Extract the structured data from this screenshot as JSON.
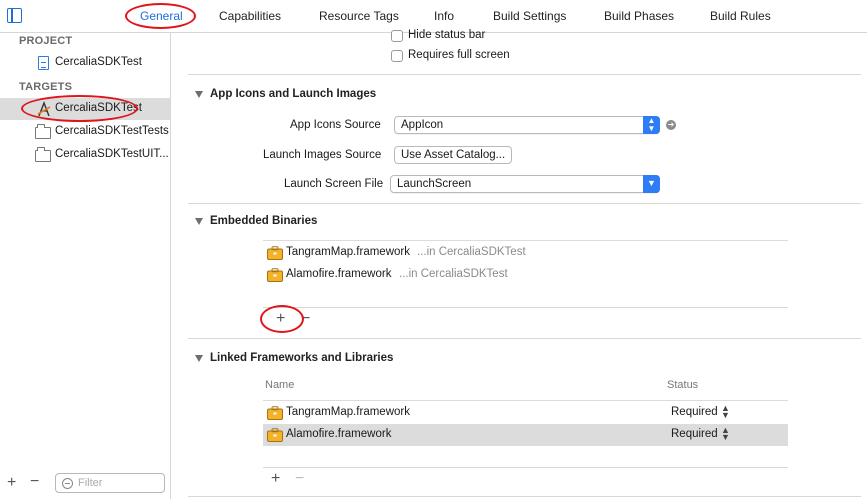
{
  "tabs": [
    {
      "label": "General",
      "active": true
    },
    {
      "label": "Capabilities"
    },
    {
      "label": "Resource Tags"
    },
    {
      "label": "Info"
    },
    {
      "label": "Build Settings"
    },
    {
      "label": "Build Phases"
    },
    {
      "label": "Build Rules"
    }
  ],
  "sidebar": {
    "project_header": "PROJECT",
    "project_item": "CercaliaSDKTest",
    "targets_header": "TARGETS",
    "targets": [
      {
        "label": "CercaliaSDKTest",
        "selected": true
      },
      {
        "label": "CercaliaSDKTestTests"
      },
      {
        "label": "CercaliaSDKTestUIT..."
      }
    ],
    "add_label": "+",
    "remove_label": "−",
    "filter_placeholder": "Filter"
  },
  "status_bar_options": {
    "hide_status_bar": "Hide status bar",
    "requires_full_screen": "Requires full screen"
  },
  "app_icons_section": {
    "title": "App Icons and Launch Images",
    "app_icons_source_label": "App Icons Source",
    "app_icons_source_value": "AppIcon",
    "launch_images_source_label": "Launch Images Source",
    "launch_images_button": "Use Asset Catalog...",
    "launch_screen_file_label": "Launch Screen File",
    "launch_screen_file_value": "LaunchScreen"
  },
  "embedded_binaries": {
    "title": "Embedded Binaries",
    "items": [
      {
        "name": "TangramMap.framework",
        "location": "...in CercaliaSDKTest"
      },
      {
        "name": "Alamofire.framework",
        "location": "...in CercaliaSDKTest"
      }
    ],
    "add_label": "+",
    "remove_label": "−"
  },
  "linked_frameworks": {
    "title": "Linked Frameworks and Libraries",
    "name_header": "Name",
    "status_header": "Status",
    "items": [
      {
        "name": "TangramMap.framework",
        "status": "Required"
      },
      {
        "name": "Alamofire.framework",
        "status": "Required",
        "selected": true
      }
    ],
    "add_label": "+",
    "remove_label": "−"
  },
  "colors": {
    "accent": "#1b6fd8",
    "highlight_annotation": "#e0141b",
    "selection": "#dcdcdc"
  }
}
